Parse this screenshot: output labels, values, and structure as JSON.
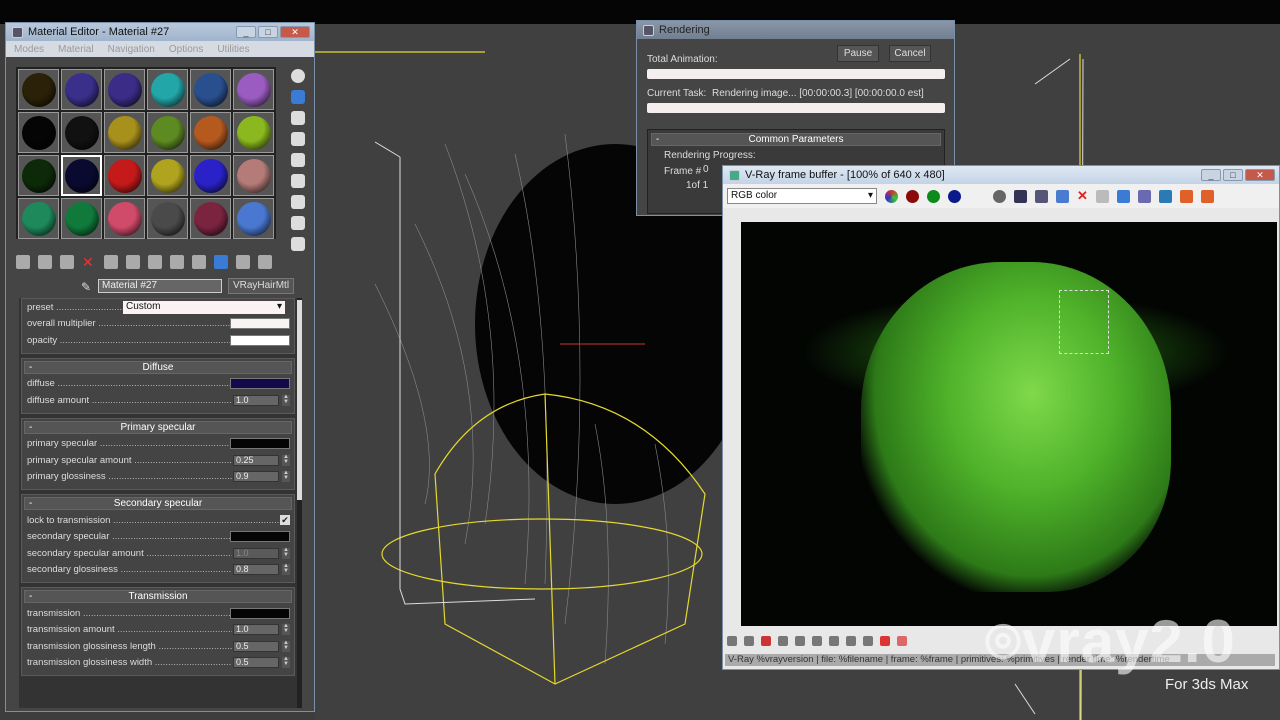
{
  "material_editor": {
    "title": "Material Editor - Material #27",
    "menu": [
      "Modes",
      "Material",
      "Navigation",
      "Options",
      "Utilities"
    ],
    "slots": [
      "#2a2108",
      "#3a2f8a",
      "#3b2c88",
      "#22a6a8",
      "#2a4f8f",
      "#9a5cc0",
      "#050505",
      "#111111",
      "#a8901c",
      "#5e8a22",
      "#b5591f",
      "#8ab81e",
      "#0d2a08",
      "#0a0a30",
      "#c41a1a",
      "#b0a41e",
      "#2a22c8",
      "#b47b78",
      "#1e8a5c",
      "#0f7a3a",
      "#d04a6a",
      "#4a4a4a",
      "#7a2440",
      "#4a78d0"
    ],
    "selected_slot": 13,
    "material_name": "Material #27",
    "material_type": "VRayHairMtl",
    "general": [
      {
        "label": "preset",
        "type": "dropdown",
        "value": "Custom"
      },
      {
        "label": "overall multiplier",
        "type": "color",
        "color": "#f8f4f4"
      },
      {
        "label": "opacity",
        "type": "color",
        "color": "#ffffff"
      }
    ],
    "rollouts": [
      {
        "title": "Diffuse",
        "rows": [
          {
            "label": "diffuse",
            "type": "color",
            "color": "#120a4a"
          },
          {
            "label": "diffuse amount",
            "type": "spinner",
            "value": "1.0"
          }
        ]
      },
      {
        "title": "Primary specular",
        "rows": [
          {
            "label": "primary specular",
            "type": "color",
            "color": "#050505"
          },
          {
            "label": "primary specular amount",
            "type": "spinner",
            "value": "0.25"
          },
          {
            "label": "primary glossiness",
            "type": "spinner",
            "value": "0.9"
          }
        ]
      },
      {
        "title": "Secondary specular",
        "rows": [
          {
            "label": "lock to transmission",
            "type": "checkbox",
            "checked": true
          },
          {
            "label": "secondary specular",
            "type": "color",
            "color": "#050505"
          },
          {
            "label": "secondary specular amount",
            "type": "spinner",
            "value": "1.0",
            "disabled": true
          },
          {
            "label": "secondary glossiness",
            "type": "spinner",
            "value": "0.8"
          }
        ]
      },
      {
        "title": "Transmission",
        "rows": [
          {
            "label": "transmission",
            "type": "color",
            "color": "#050505"
          },
          {
            "label": "transmission amount",
            "type": "spinner",
            "value": "1.0"
          },
          {
            "label": "transmission glossiness length",
            "type": "spinner",
            "value": "0.5"
          },
          {
            "label": "transmission glossiness width",
            "type": "spinner",
            "value": "0.5"
          }
        ]
      }
    ]
  },
  "rendering": {
    "title": "Rendering",
    "pause": "Pause",
    "cancel": "Cancel",
    "total_animation": "Total Animation:",
    "current_task_label": "Current Task:",
    "current_task": "Rendering image... [00:00:00.3] [00:00:00.0 est]",
    "common_parameters": "Common Parameters",
    "rendering_progress": "Rendering Progress:",
    "frame_label": "Frame #",
    "frame_value": "0",
    "of": "1of 1"
  },
  "vfb": {
    "title": "V-Ray frame buffer - [100% of 640 x 480]",
    "channel": "RGB color",
    "status": "V-Ray %vrayversion | file: %filename | frame: %frame | primitives: %primitives | render time: %rendertime"
  },
  "watermark": {
    "logo": "vray2.0",
    "subtitle": "For 3ds Max"
  }
}
